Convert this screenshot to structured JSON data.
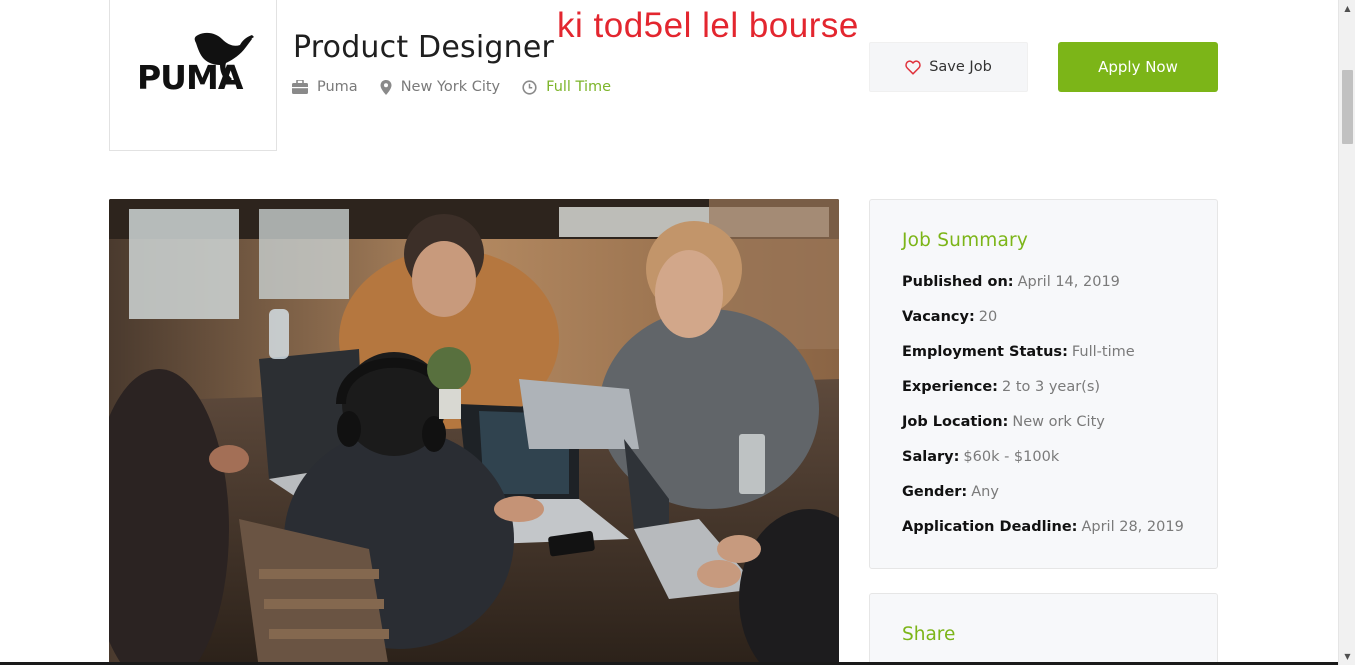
{
  "overlay_text": "ki tod5el lel bourse",
  "company_logo_text": "PUMA",
  "job": {
    "title": "Product Designer",
    "company": "Puma",
    "location": "New York City",
    "type": "Full Time"
  },
  "actions": {
    "save_label": "Save Job",
    "apply_label": "Apply Now"
  },
  "summary": {
    "heading": "Job Summary",
    "rows": [
      {
        "label": "Published on:",
        "value": "April 14, 2019"
      },
      {
        "label": "Vacancy:",
        "value": "20"
      },
      {
        "label": "Employment Status:",
        "value": "Full-time"
      },
      {
        "label": "Experience:",
        "value": "2 to 3 year(s)"
      },
      {
        "label": "Job Location:",
        "value": "New ork City"
      },
      {
        "label": "Salary:",
        "value": "$60k - $100k"
      },
      {
        "label": "Gender:",
        "value": "Any"
      },
      {
        "label": "Application Deadline:",
        "value": "April 28, 2019"
      }
    ]
  },
  "share": {
    "heading": "Share"
  },
  "colors": {
    "accent": "#7cb518",
    "overlay": "#e3262f",
    "heart": "#e0323c"
  },
  "icons": [
    "briefcase-icon",
    "map-pin-icon",
    "clock-icon",
    "heart-icon"
  ]
}
